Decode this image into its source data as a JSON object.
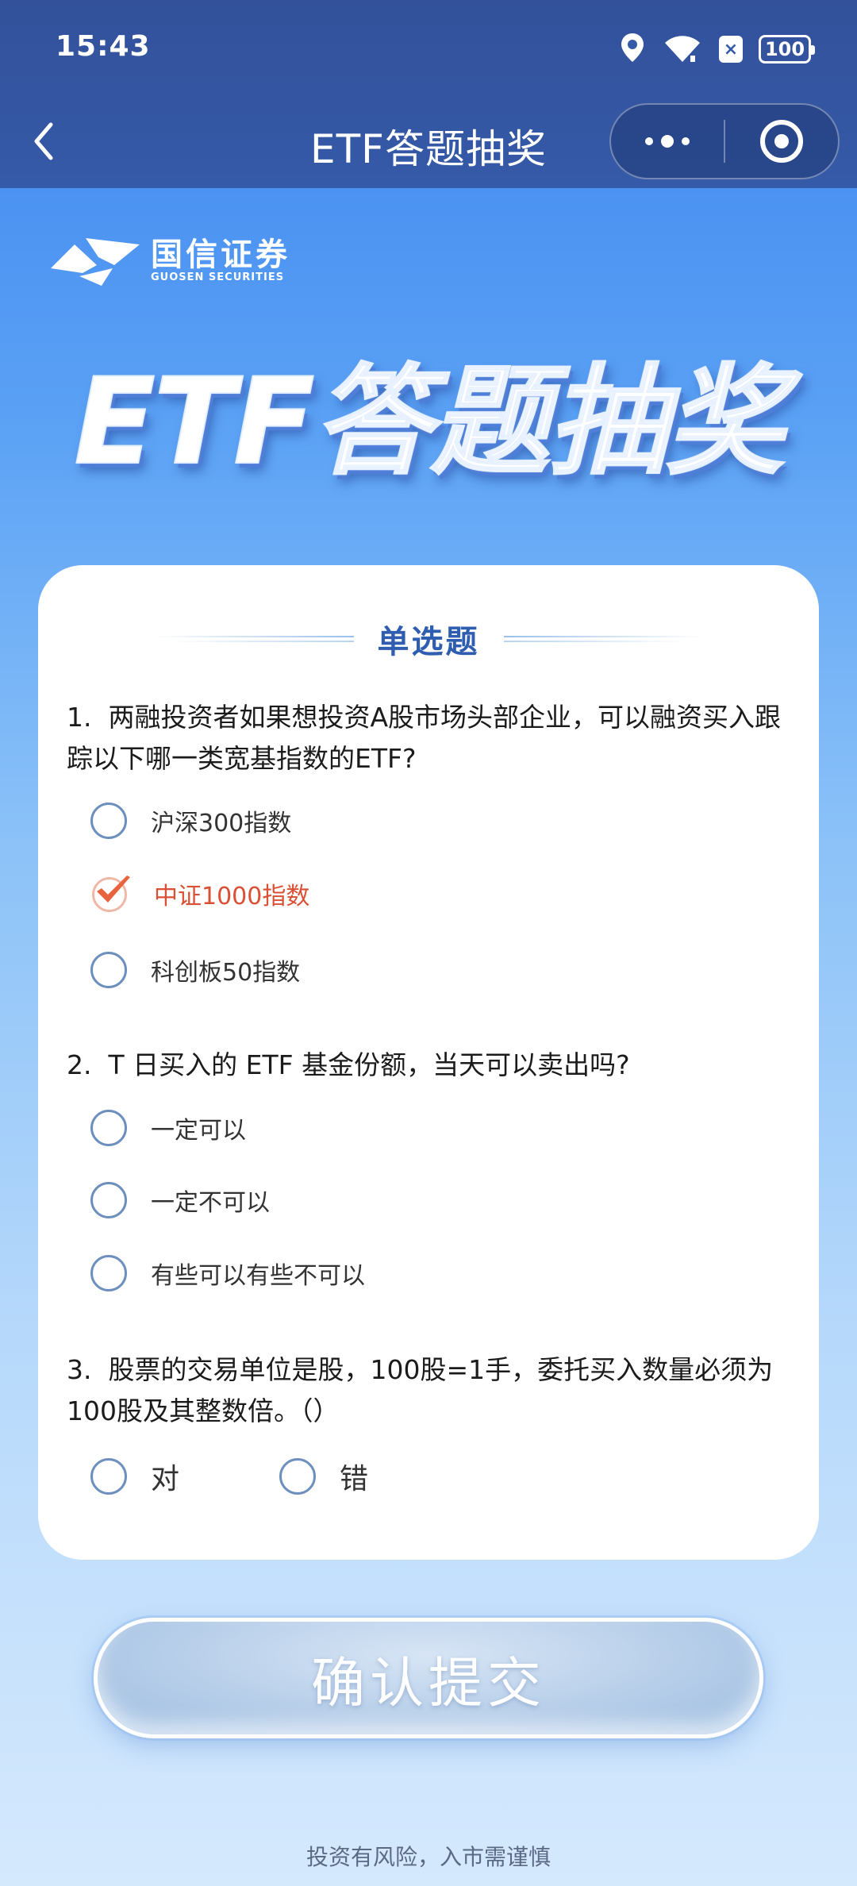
{
  "status_bar": {
    "time": "15:43",
    "battery": "100",
    "x_badge": "×"
  },
  "nav": {
    "title": "ETF答题抽奖"
  },
  "brand": {
    "name_cn": "国信证券",
    "name_en": "GUOSEN SECURITIES"
  },
  "hero": {
    "title": "ETF答题抽奖"
  },
  "section": {
    "title": "单选题"
  },
  "questions": [
    {
      "number": "1.",
      "text": "两融投资者如果想投资A股市场头部企业，可以融资买入跟踪以下哪一类宽基指数的ETF?",
      "options": [
        {
          "label": "沪深300指数",
          "selected": false
        },
        {
          "label": "中证1000指数",
          "selected": true
        },
        {
          "label": "科创板50指数",
          "selected": false
        }
      ]
    },
    {
      "number": "2.",
      "text": "T 日买入的 ETF 基金份额，当天可以卖出吗?",
      "options": [
        {
          "label": "一定可以",
          "selected": false
        },
        {
          "label": "一定不可以",
          "selected": false
        },
        {
          "label": "有些可以有些不可以",
          "selected": false
        }
      ]
    },
    {
      "number": "3.",
      "text": "股票的交易单位是股，100股=1手，委托买入数量必须为100股及其整数倍。（）",
      "options": [
        {
          "label": "对",
          "selected": false
        },
        {
          "label": "错",
          "selected": false
        }
      ]
    }
  ],
  "submit": {
    "label": "确认提交"
  },
  "footer": {
    "note": "投资有风险，入市需谨慎"
  },
  "colors": {
    "header": "#355aa8",
    "accent": "#2f5db0",
    "selected": "#d95034"
  }
}
